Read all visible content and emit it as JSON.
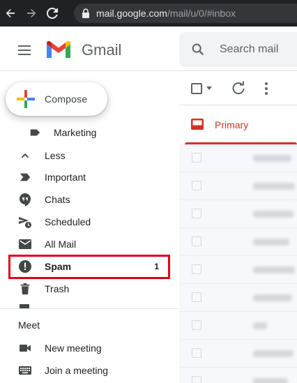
{
  "browser": {
    "url_host": "mail.google.com",
    "url_path": "/mail/u/0/#inbox"
  },
  "header": {
    "brand": "Gmail",
    "search_placeholder": "Search mail"
  },
  "compose": {
    "label": "Compose"
  },
  "sidebar": {
    "items": [
      {
        "label": "Marketing",
        "icon": "label-icon",
        "count": ""
      },
      {
        "label": "Less",
        "icon": "chevron-up-icon",
        "count": ""
      },
      {
        "label": "Important",
        "icon": "important-icon",
        "count": ""
      },
      {
        "label": "Chats",
        "icon": "chat-icon",
        "count": ""
      },
      {
        "label": "Scheduled",
        "icon": "scheduled-send-icon",
        "count": ""
      },
      {
        "label": "All Mail",
        "icon": "mail-icon",
        "count": ""
      },
      {
        "label": "Spam",
        "icon": "spam-icon",
        "count": "1"
      },
      {
        "label": "Trash",
        "icon": "trash-icon",
        "count": ""
      }
    ]
  },
  "meet": {
    "title": "Meet",
    "items": [
      {
        "label": "New meeting",
        "icon": "videocam-icon"
      },
      {
        "label": "Join a meeting",
        "icon": "keyboard-icon"
      }
    ]
  },
  "main": {
    "tabs": [
      {
        "label": "Primary",
        "icon": "inbox-icon"
      }
    ]
  },
  "colors": {
    "accent_red": "#d93025",
    "highlight_border": "#e4001b",
    "chrome_dark": "#202124"
  }
}
